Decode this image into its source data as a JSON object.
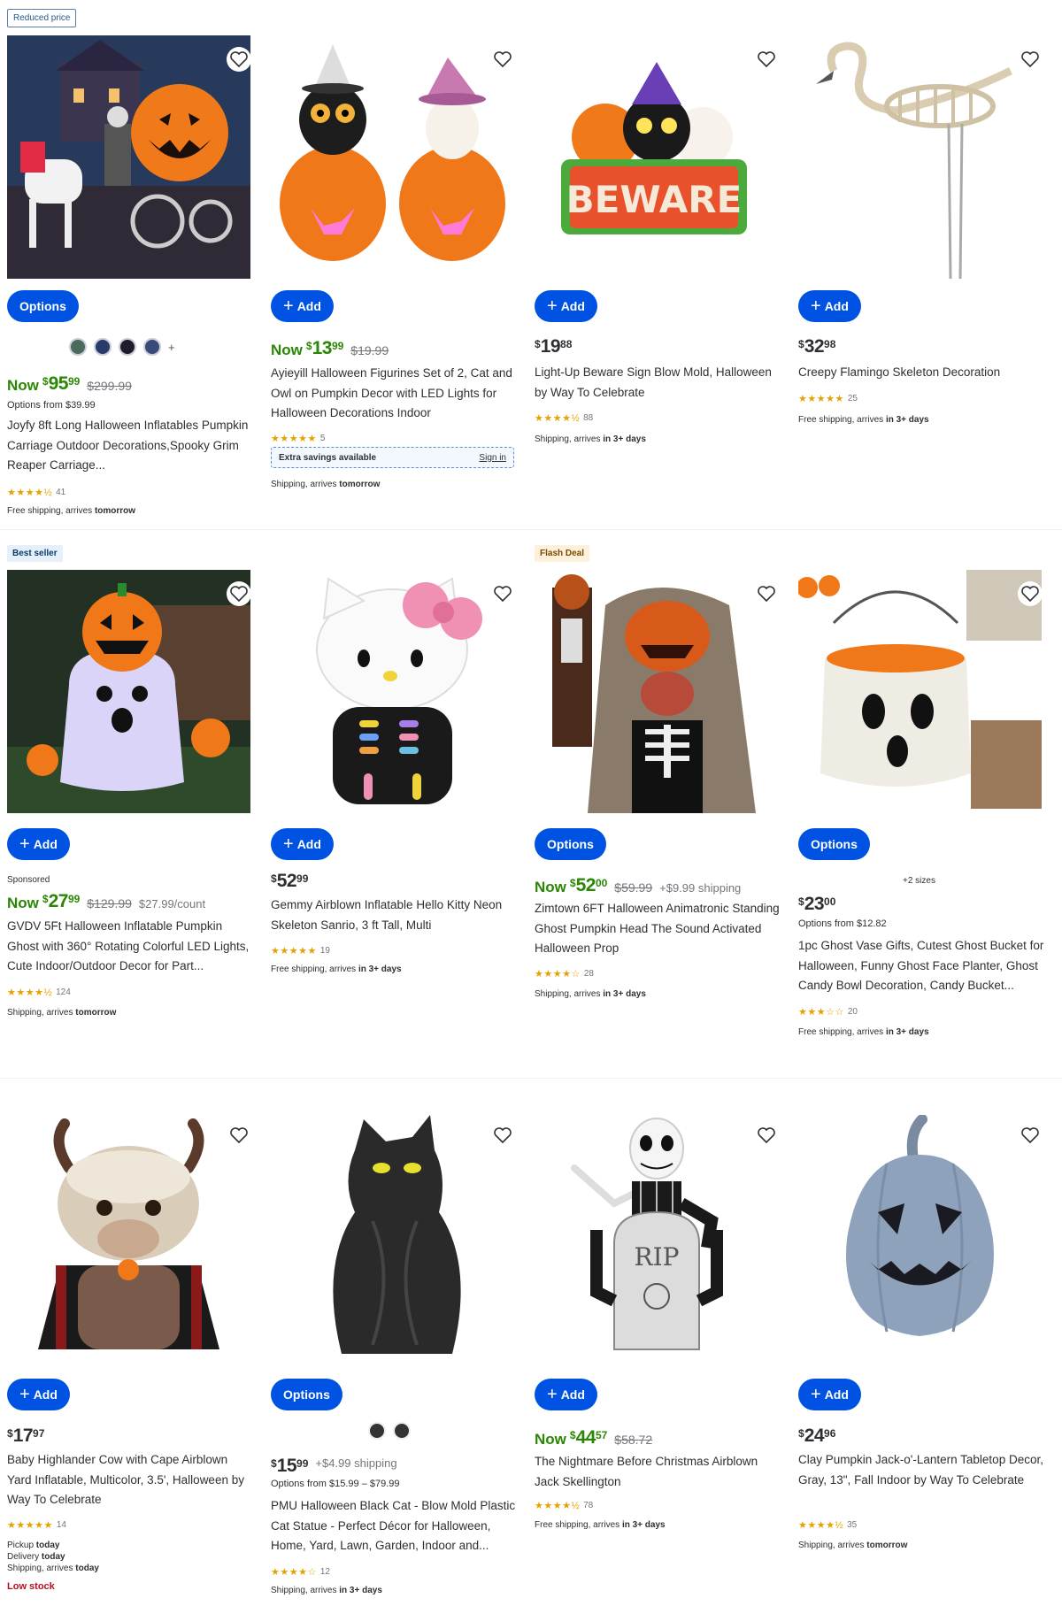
{
  "products": [
    {
      "badge": "Reduced price",
      "button": "Options",
      "price_prefix": "Now",
      "price_dollars": "95",
      "price_cents": "99",
      "was_price": "$299.99",
      "extra": "",
      "options_from": "Options from $39.99",
      "title": "Joyfy 8ft Long Halloween Inflatables Pumpkin Carriage Outdoor Decorations,Spooky Grim Reaper Carriage...",
      "rating": 4.5,
      "review_count": "41",
      "shipping_prefix": "Free shipping, arrives",
      "shipping_bold": "tomorrow",
      "image": "pumpkin-carriage-inflatable"
    },
    {
      "badge": "",
      "button": "Add",
      "price_prefix": "Now",
      "price_dollars": "13",
      "price_cents": "99",
      "was_price": "$19.99",
      "extra": "",
      "title": "Ayieyill Halloween Figurines Set of 2, Cat and Owl on Pumpkin Decor with LED Lights for Halloween Decorations Indoor",
      "rating": 5,
      "review_count": "5",
      "extra_savings": "Extra savings available",
      "sign_in": "Sign in",
      "shipping_prefix": "Shipping, arrives",
      "shipping_bold": "tomorrow",
      "image": "owl-cat-pumpkins"
    },
    {
      "badge": "",
      "button": "Add",
      "price_prefix": "",
      "price_dollars": "19",
      "price_cents": "88",
      "was_price": "",
      "title": "Light-Up Beware Sign Blow Mold, Halloween by Way To Celebrate",
      "rating": 4.5,
      "review_count": "88",
      "shipping_prefix": "Shipping, arrives",
      "shipping_bold": "in 3+ days",
      "image": "beware-sign",
      "sign_text": "BEWARE"
    },
    {
      "badge": "",
      "button": "Add",
      "price_prefix": "",
      "price_dollars": "32",
      "price_cents": "98",
      "was_price": "",
      "title": "Creepy Flamingo Skeleton Decoration",
      "rating": 5,
      "review_count": "25",
      "shipping_prefix": "Free shipping, arrives",
      "shipping_bold": "in 3+ days",
      "image": "flamingo-skeleton"
    },
    {
      "badge": "Best seller",
      "button": "Add",
      "sponsored": "Sponsored",
      "price_prefix": "Now",
      "price_dollars": "27",
      "price_cents": "99",
      "was_price": "$129.99",
      "extra": "$27.99/count",
      "title": "GVDV 5Ft Halloween Inflatable Pumpkin Ghost with 360° Rotating Colorful LED Lights, Cute Indoor/Outdoor Decor for Part...",
      "rating": 4.5,
      "review_count": "124",
      "shipping_prefix": "Shipping, arrives",
      "shipping_bold": "tomorrow",
      "image": "pumpkin-ghost-inflatable"
    },
    {
      "badge": "",
      "button": "Add",
      "price_prefix": "",
      "price_dollars": "52",
      "price_cents": "99",
      "was_price": "",
      "title": "Gemmy Airblown Inflatable Hello Kitty Neon Skeleton Sanrio, 3 ft Tall, Multi",
      "rating": 5,
      "review_count": "19",
      "shipping_prefix": "Free shipping, arrives",
      "shipping_bold": "in 3+ days",
      "image": "hello-kitty-inflatable"
    },
    {
      "badge": "Flash Deal",
      "button": "Options",
      "price_prefix": "Now",
      "price_dollars": "52",
      "price_cents": "00",
      "was_price": "$59.99",
      "extra": "+$9.99 shipping",
      "title": "Zimtown 6FT Halloween Animatronic Standing Ghost Pumpkin Head The Sound Activated Halloween Prop",
      "rating": 4,
      "review_count": "28",
      "shipping_prefix": "Shipping, arrives",
      "shipping_bold": "in 3+ days",
      "image": "ghost-animatronic"
    },
    {
      "badge": "",
      "button": "Options",
      "sizes": "+2 sizes",
      "price_prefix": "",
      "price_dollars": "23",
      "price_cents": "00",
      "was_price": "",
      "options_from": "Options from $12.82",
      "title": "1pc Ghost Vase Gifts, Cutest Ghost Bucket for Halloween, Funny Ghost Face Planter, Ghost Candy Bowl Decoration, Candy Bucket...",
      "rating": 3,
      "review_count": "20",
      "shipping_prefix": "Free shipping, arrives",
      "shipping_bold": "in 3+ days",
      "image": "ghost-bucket"
    },
    {
      "badge": "",
      "button": "Add",
      "price_prefix": "",
      "price_dollars": "17",
      "price_cents": "97",
      "was_price": "",
      "title": "Baby Highlander Cow with Cape Airblown Yard Inflatable, Multicolor, 3.5', Halloween by Way To Celebrate",
      "rating": 5,
      "review_count": "14",
      "pickup_prefix": "Pickup",
      "pickup_bold": "today",
      "delivery_prefix": "Delivery",
      "delivery_bold": "today",
      "shipping_prefix": "Shipping, arrives",
      "shipping_bold": "today",
      "low_stock": "Low stock",
      "image": "highland-cow-inflatable"
    },
    {
      "badge": "",
      "button": "Options",
      "price_prefix": "",
      "price_dollars": "15",
      "price_cents": "99",
      "was_price": "",
      "extra": "+$4.99 shipping",
      "options_from": "Options from $15.99 – $79.99",
      "title": "PMU Halloween Black Cat - Blow Mold Plastic Cat Statue - Perfect Décor for Halloween, Home, Yard, Lawn, Garden, Indoor and...",
      "rating": 4,
      "review_count": "12",
      "shipping_prefix": "Shipping, arrives",
      "shipping_bold": "in 3+ days",
      "image": "black-cat-blow-mold"
    },
    {
      "badge": "",
      "button": "Add",
      "price_prefix": "Now",
      "price_dollars": "44",
      "price_cents": "57",
      "was_price": "$58.72",
      "title": "The Nightmare Before Christmas Airblown Jack Skellington",
      "rating": 4.5,
      "review_count": "78",
      "shipping_prefix": "Free shipping, arrives",
      "shipping_bold": "in 3+ days",
      "image": "jack-skellington-inflatable",
      "tombstone_text": "RIP"
    },
    {
      "badge": "",
      "button": "Add",
      "price_prefix": "",
      "price_dollars": "24",
      "price_cents": "96",
      "was_price": "",
      "title": "Clay Pumpkin Jack-o'-Lantern Tabletop Decor, Gray, 13\", Fall Indoor by Way To Celebrate",
      "rating": 4.5,
      "review_count": "35",
      "shipping_prefix": "Shipping, arrives",
      "shipping_bold": "tomorrow",
      "image": "gray-clay-pumpkin"
    }
  ],
  "currency_symbol": "$",
  "colors": {
    "primary_button": "#0053e2",
    "now_price": "#2a8703",
    "star": "#e5a100",
    "low_stock": "#b5121b"
  }
}
